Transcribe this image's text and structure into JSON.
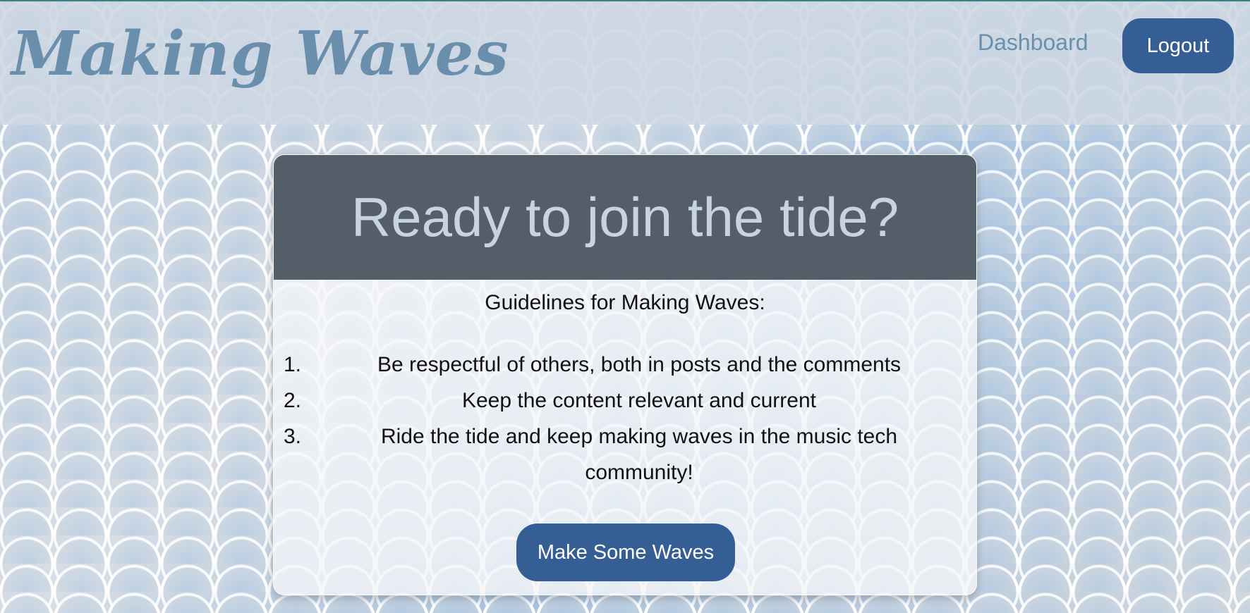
{
  "header": {
    "brand": "Making Waves",
    "nav_dashboard": "Dashboard",
    "logout_label": "Logout"
  },
  "card": {
    "title": "Ready to join the tide?",
    "guidelines_heading": "Guidelines for Making Waves:",
    "guidelines": [
      {
        "number": "1.",
        "text": "Be respectful of others, both in posts and the comments"
      },
      {
        "number": "2.",
        "text": "Keep the content relevant and current"
      },
      {
        "number": "3.",
        "text": "Ride the tide and keep making waves in the music tech community!"
      }
    ],
    "cta_label": "Make Some Waves"
  },
  "colors": {
    "brand": "#6a8fac",
    "button": "#355f94",
    "card_header": "#545e69",
    "card_title": "#c7d3e0"
  }
}
